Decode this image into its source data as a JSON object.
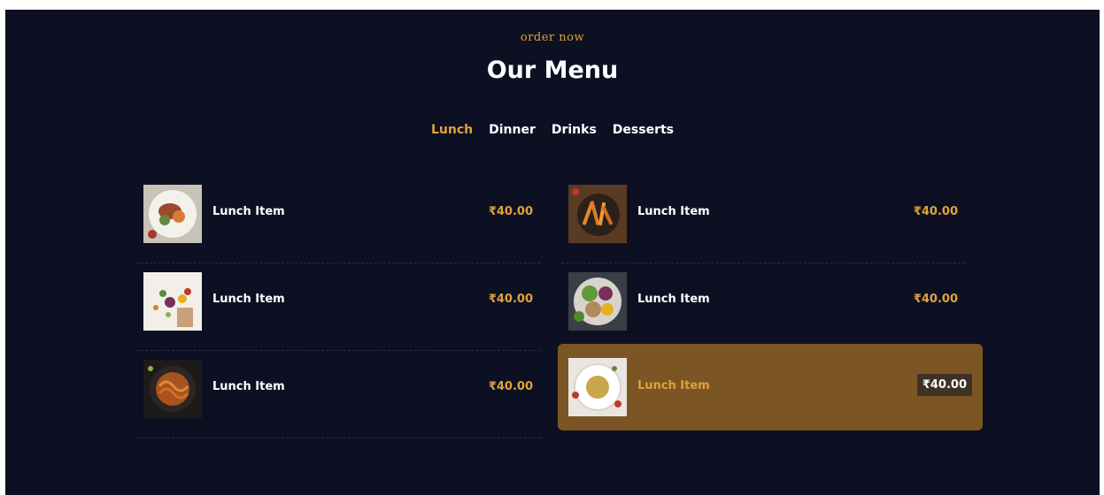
{
  "header": {
    "eyebrow": "order now",
    "title": "Our Menu"
  },
  "tabs": [
    {
      "label": "Lunch",
      "active": true
    },
    {
      "label": "Dinner",
      "active": false
    },
    {
      "label": "Drinks",
      "active": false
    },
    {
      "label": "Desserts",
      "active": false
    }
  ],
  "menu": {
    "items": [
      {
        "name": "Lunch Item",
        "price": "₹40.00",
        "image": "plated-dish"
      },
      {
        "name": "Lunch Item",
        "price": "₹40.00",
        "image": "fries-bowl"
      },
      {
        "name": "Lunch Item",
        "price": "₹40.00",
        "image": "vegetables"
      },
      {
        "name": "Lunch Item",
        "price": "₹40.00",
        "image": "salad-bowl"
      },
      {
        "name": "Lunch Item",
        "price": "₹40.00",
        "image": "noodle-bowl"
      },
      {
        "name": "Lunch Item",
        "price": "₹40.00",
        "image": "rice-plate",
        "highlighted": true
      }
    ]
  },
  "colors": {
    "background": "#0c1022",
    "accent": "#e0a23a",
    "highlight": "#7b5624"
  }
}
